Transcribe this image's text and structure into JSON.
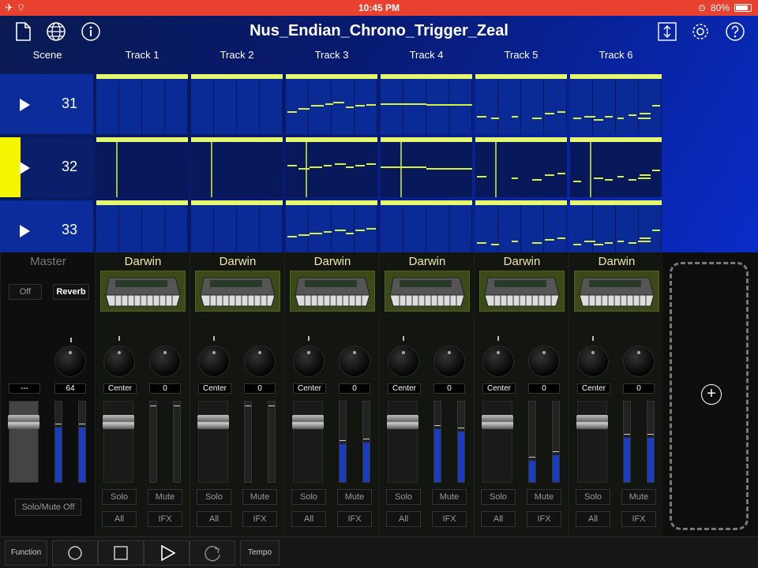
{
  "status_bar": {
    "time": "10:45 PM",
    "battery": "80%"
  },
  "header": {
    "title": "Nus_Endian_Chrono_Trigger_Zeal",
    "left_icons": [
      "document-icon",
      "globe-icon",
      "info-icon"
    ],
    "right_icons": [
      "export-icon",
      "gear-icon",
      "help-icon"
    ]
  },
  "columns": {
    "scene_label": "Scene",
    "tracks": [
      "Track 1",
      "Track 2",
      "Track 3",
      "Track 4",
      "Track 5",
      "Track 6"
    ]
  },
  "scenes": [
    {
      "number": "31",
      "active": false
    },
    {
      "number": "32",
      "active": true
    },
    {
      "number": "33",
      "active": false
    }
  ],
  "master": {
    "label": "Master",
    "off_label": "Off",
    "reverb_label": "Reverb",
    "pan_value": "---",
    "volume_value": "64",
    "solo_mute_label": "Solo/Mute Off",
    "meter_levels": [
      0.68,
      0.68
    ]
  },
  "strips": [
    {
      "instrument": "Darwin",
      "pan": "Center",
      "send": "0",
      "solo": "Solo",
      "mute": "Mute",
      "all": "All",
      "ifx": "IFX",
      "meter_levels": [
        0,
        0
      ]
    },
    {
      "instrument": "Darwin",
      "pan": "Center",
      "send": "0",
      "solo": "Solo",
      "mute": "Mute",
      "all": "All",
      "ifx": "IFX",
      "meter_levels": [
        0,
        0
      ]
    },
    {
      "instrument": "Darwin",
      "pan": "Center",
      "send": "0",
      "solo": "Solo",
      "mute": "Mute",
      "all": "All",
      "ifx": "IFX",
      "meter_levels": [
        0.47,
        0.49
      ]
    },
    {
      "instrument": "Darwin",
      "pan": "Center",
      "send": "0",
      "solo": "Solo",
      "mute": "Mute",
      "all": "All",
      "ifx": "IFX",
      "meter_levels": [
        0.66,
        0.63
      ]
    },
    {
      "instrument": "Darwin",
      "pan": "Center",
      "send": "0",
      "solo": "Solo",
      "mute": "Mute",
      "all": "All",
      "ifx": "IFX",
      "meter_levels": [
        0.26,
        0.33
      ]
    },
    {
      "instrument": "Darwin",
      "pan": "Center",
      "send": "0",
      "solo": "Solo",
      "mute": "Mute",
      "all": "All",
      "ifx": "IFX",
      "meter_levels": [
        0.55,
        0.55
      ]
    }
  ],
  "add_track": {
    "icon": "plus-circle-icon"
  },
  "transport": {
    "function_label": "Function",
    "tempo_label": "Tempo",
    "icons": [
      "record-icon",
      "stop-icon",
      "play-icon",
      "loop-icon"
    ]
  },
  "colors": {
    "accent": "#f5f500",
    "clip_bar": "#e4f870",
    "clip_bg": "#0a2a95",
    "meter": "#1b3dbd",
    "status_bar": "#e8412f"
  }
}
